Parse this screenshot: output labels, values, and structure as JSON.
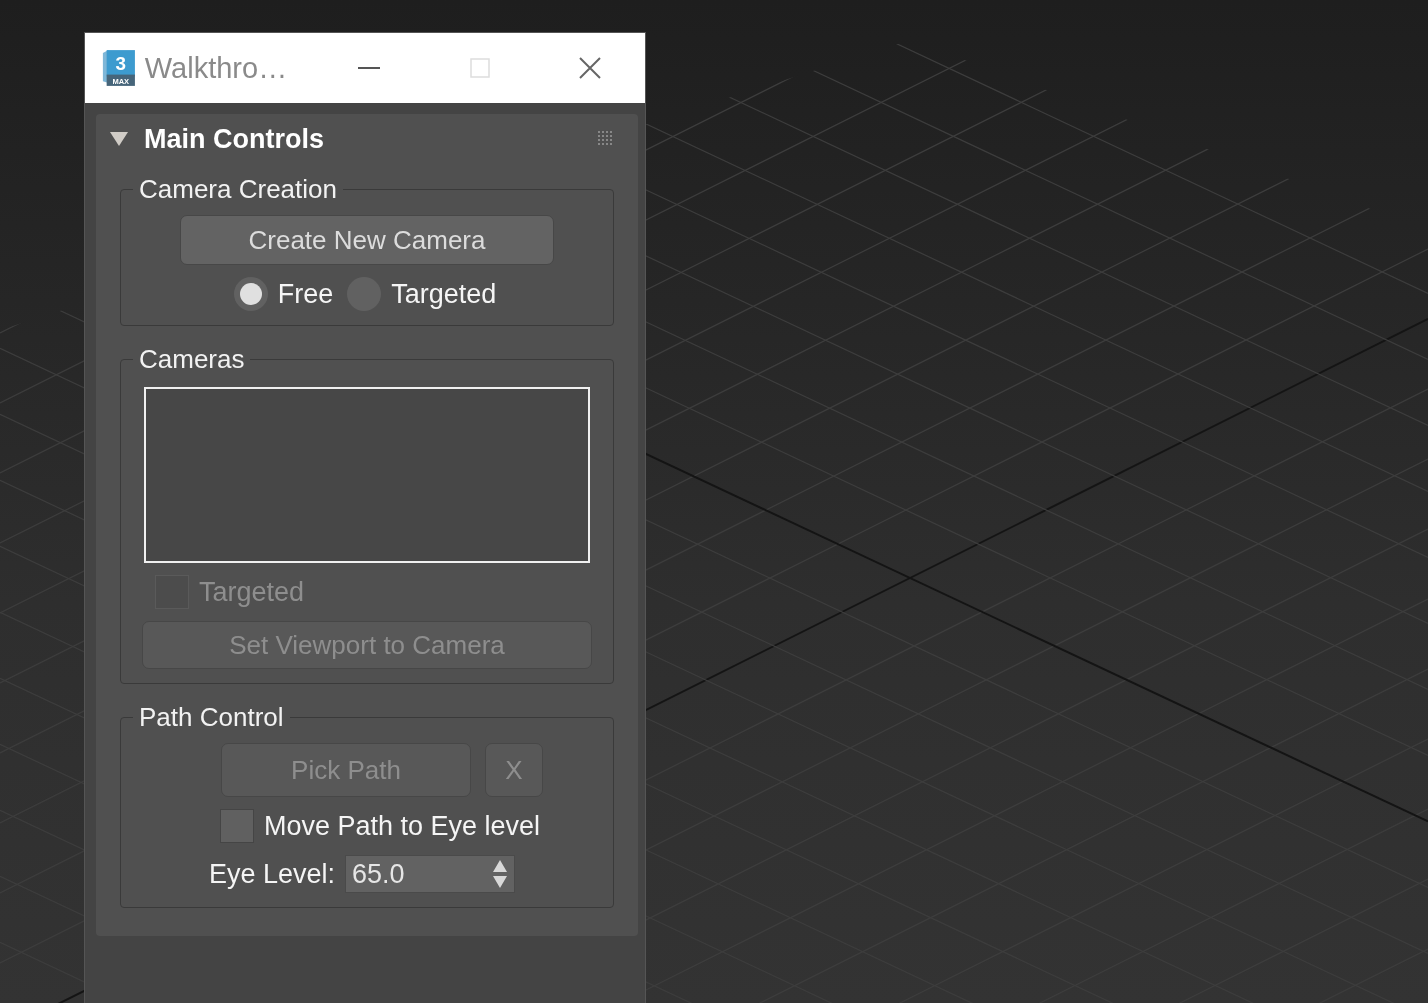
{
  "window": {
    "title": "Walkthro…",
    "logo": {
      "number": "3",
      "caption": "MAX"
    }
  },
  "rollout": {
    "title": "Main Controls",
    "expanded": true,
    "camera_creation": {
      "title": "Camera Creation",
      "button": "Create New Camera",
      "radios": [
        {
          "label": "Free",
          "selected": true
        },
        {
          "label": "Targeted",
          "selected": false
        }
      ]
    },
    "cameras": {
      "title": "Cameras",
      "checkbox": {
        "label": "Targeted",
        "checked": false,
        "disabled": true
      },
      "button": {
        "label": "Set Viewport to Camera",
        "disabled": true
      }
    },
    "path_control": {
      "title": "Path Control",
      "pick_button": {
        "label": "Pick Path",
        "disabled": true
      },
      "clear_button": {
        "label": "X",
        "disabled": true
      },
      "checkbox": {
        "label": "Move Path to Eye level",
        "checked": false,
        "disabled": false
      },
      "eye_level": {
        "label": "Eye Level:",
        "value": "65.0"
      }
    }
  }
}
